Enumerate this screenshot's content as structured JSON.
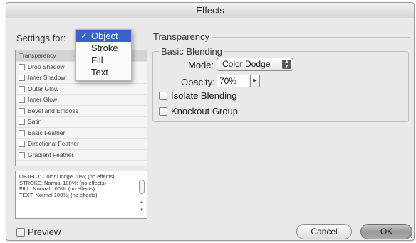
{
  "window": {
    "title": "Effects"
  },
  "settings": {
    "label": "Settings for:",
    "menu": [
      {
        "label": "Object",
        "selected": true
      },
      {
        "label": "Stroke",
        "selected": false
      },
      {
        "label": "Fill",
        "selected": false
      },
      {
        "label": "Text",
        "selected": false
      }
    ]
  },
  "effects_list": {
    "header": "Transparency",
    "items": [
      "Drop Shadow",
      "Inner Shadow",
      "Outer Glow",
      "Inner Glow",
      "Bevel and Emboss",
      "Satin",
      "Basic Feather",
      "Directional Feather",
      "Gradient Feather"
    ]
  },
  "summary": {
    "lines": [
      "OBJECT: Color Dodge 70%; (no effects)",
      "STROKE: Normal 100%; (no effects)",
      "FILL: Normal 100%; (no effects)",
      "TEXT: Normal 100%; (no effects)"
    ]
  },
  "transparency": {
    "title": "Transparency",
    "basic_blending": {
      "title": "Basic Blending",
      "mode_label": "Mode:",
      "mode_value": "Color Dodge",
      "opacity_label": "Opacity:",
      "opacity_value": "70%"
    },
    "isolate_label": "Isolate Blending",
    "knockout_label": "Knockout Group"
  },
  "footer": {
    "preview_label": "Preview",
    "cancel_label": "Cancel",
    "ok_label": "OK"
  },
  "colors": {
    "menu_highlight": "#3b62c9",
    "window_bg": "#e9e9e9"
  }
}
